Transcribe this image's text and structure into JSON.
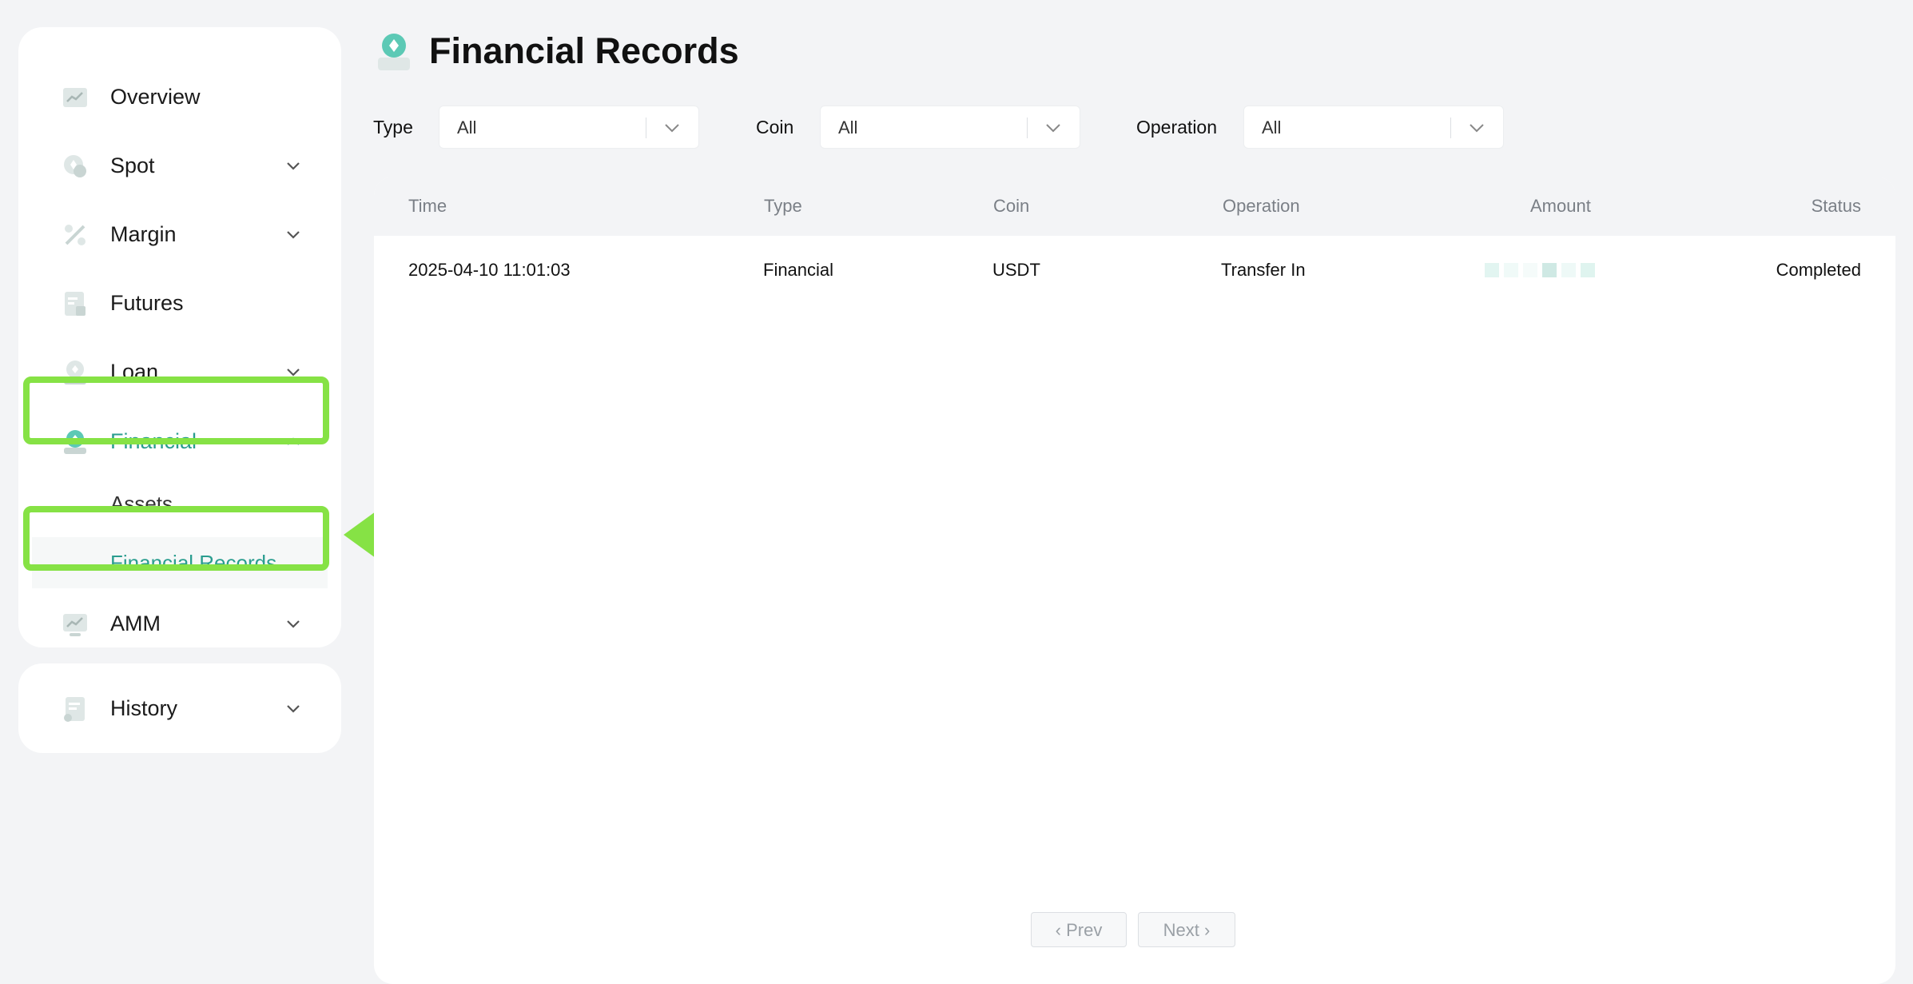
{
  "sidebar": {
    "items": [
      {
        "label": "Overview",
        "icon": "chart-icon"
      },
      {
        "label": "Spot",
        "icon": "coin-icon"
      },
      {
        "label": "Margin",
        "icon": "percent-icon"
      },
      {
        "label": "Futures",
        "icon": "document-icon"
      },
      {
        "label": "Loan",
        "icon": "loan-icon"
      },
      {
        "label": "Financial",
        "icon": "financial-icon"
      },
      {
        "label": "AMM",
        "icon": "amm-icon"
      }
    ],
    "financial_sub": [
      {
        "label": "Assets"
      },
      {
        "label": "Financial Records"
      }
    ],
    "history": {
      "label": "History",
      "icon": "history-icon"
    }
  },
  "page": {
    "title": "Financial Records",
    "title_icon": "financial-icon"
  },
  "filters": [
    {
      "label": "Type",
      "value": "All"
    },
    {
      "label": "Coin",
      "value": "All"
    },
    {
      "label": "Operation",
      "value": "All"
    }
  ],
  "table": {
    "headers": [
      "Time",
      "Type",
      "Coin",
      "Operation",
      "Amount",
      "Status"
    ],
    "rows": [
      {
        "time": "2025-04-10 11:01:03",
        "type": "Financial",
        "coin": "USDT",
        "operation": "Transfer In",
        "amount": "",
        "status": "Completed"
      }
    ]
  },
  "pagination": {
    "prev": "Prev",
    "next": "Next"
  },
  "colors": {
    "accent": "#2a9d8f",
    "highlight": "#86e245",
    "background": "#f3f4f6"
  }
}
